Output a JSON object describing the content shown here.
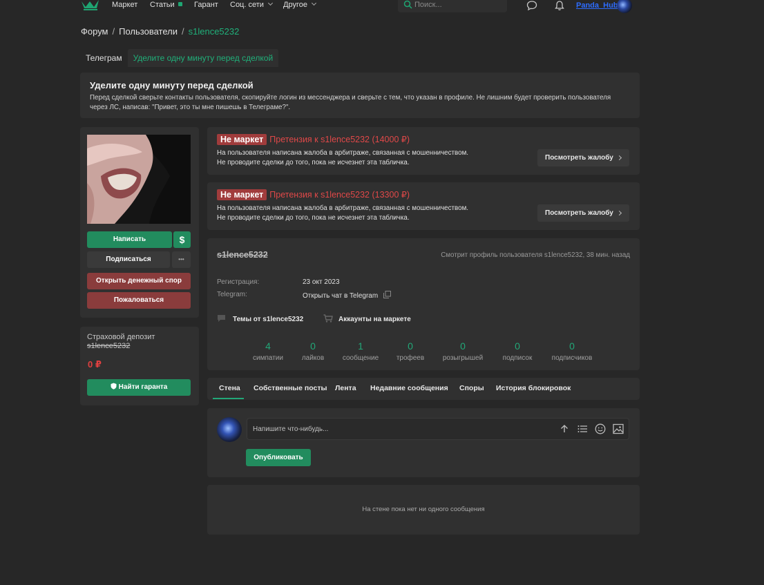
{
  "nav": {
    "items": [
      "Маркет",
      "Статьи",
      "Гарант",
      "Соц. сети",
      "Другое"
    ],
    "search_placeholder": "Поиск...",
    "username": "Panda_Hub"
  },
  "breadcrumb": {
    "forum": "Форум",
    "users": "Пользователи",
    "current": "s1lence5232",
    "separator": "/"
  },
  "telegram_tabs": {
    "telegram": "Телеграм",
    "minute": "Уделите одну минуту перед сделкой"
  },
  "notice": {
    "title": "Уделите одну минуту перед сделкой",
    "text": "Перед сделкой сверьте контакты пользователя, скопируйте логин из мессенджера и сверьте с тем, что указан в профиле. Не лишним будет проверить пользователя через ЛС, написав: \"Привет, это ты мне пишешь в Телеграме?\"."
  },
  "sidebar": {
    "write": "Написать",
    "dollar": "$",
    "subscribe": "Подписаться",
    "more": "•••",
    "open_dispute": "Открыть денежный спор",
    "complain": "Пожаловаться",
    "deposit_title": "Страховой депозит",
    "deposit_user": "s1lence5232",
    "deposit_amount": "0 ₽",
    "find_guarantor": "Найти гаранта"
  },
  "claims": [
    {
      "badge": "Не маркет",
      "title": "Претензия к s1lence5232 (14000 ₽)",
      "line1": "На пользователя написана жалоба в арбитраже, связанная с мошенничеством.",
      "line2": "Не проводите сделки до того, пока не исчезнет эта табличка.",
      "button": "Посмотреть жалобу"
    },
    {
      "badge": "Не маркет",
      "title": "Претензия к s1lence5232 (13300 ₽)",
      "line1": "На пользователя написана жалоба в арбитраже, связанная с мошенничеством.",
      "line2": "Не проводите сделки до того, пока не исчезнет эта табличка.",
      "button": "Посмотреть жалобу"
    }
  ],
  "profile": {
    "name": "s1lence5232",
    "viewing": "Смотрит профиль пользователя s1lence5232, 38 мин. назад",
    "reg_label": "Регистрация:",
    "reg_value": "23 окт 2023",
    "tg_label": "Telegram:",
    "tg_value": "Открыть чат в Telegram",
    "threads_link": "Темы от s1lence5232",
    "market_link": "Аккаунты на маркете",
    "stats": [
      {
        "num": "4",
        "label": "симпатии"
      },
      {
        "num": "0",
        "label": "лайков"
      },
      {
        "num": "1",
        "label": "сообщение"
      },
      {
        "num": "0",
        "label": "трофеев"
      },
      {
        "num": "0",
        "label": "розыгрышей"
      },
      {
        "num": "0",
        "label": "подписок"
      },
      {
        "num": "0",
        "label": "подписчиков"
      }
    ]
  },
  "tabs": [
    "Стена",
    "Собственные посты",
    "Лента",
    "Недавние сообщения",
    "Споры",
    "История блокировок"
  ],
  "post": {
    "placeholder": "Напишите что-нибудь...",
    "publish": "Опубликовать"
  },
  "wall": {
    "empty": "На стене пока нет ни одного сообщения"
  }
}
